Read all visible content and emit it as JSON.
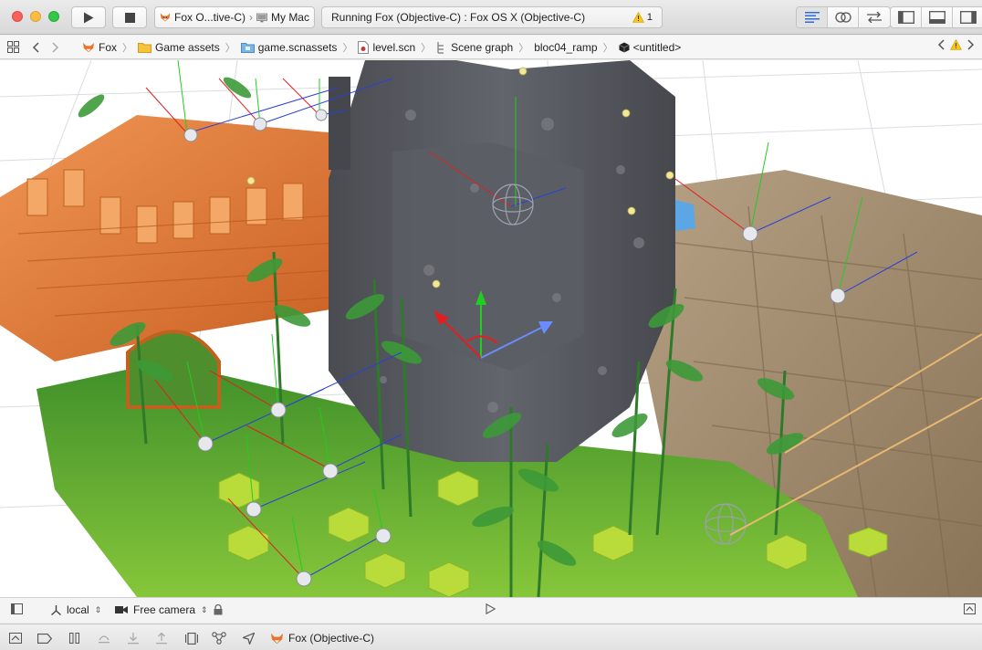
{
  "toolbar": {
    "scheme_name": "Fox O...tive-C)",
    "device_name": "My Mac",
    "activity_text": "Running Fox (Objective-C) : Fox OS X (Objective-C)",
    "warning_count": "1"
  },
  "jumpbar": {
    "crumbs": [
      {
        "label": "Fox",
        "icon": "project-icon"
      },
      {
        "label": "Game assets",
        "icon": "folder-icon"
      },
      {
        "label": "game.scnassets",
        "icon": "scnassets-folder-icon"
      },
      {
        "label": "level.scn",
        "icon": "scene-file-icon"
      },
      {
        "label": "Scene graph",
        "icon": "scene-graph-icon"
      },
      {
        "label": "bloc04_ramp",
        "icon": ""
      },
      {
        "label": "<untitled>",
        "icon": "cube-icon"
      }
    ]
  },
  "scenebar": {
    "coordinate_mode": "local",
    "camera": "Free camera"
  },
  "debugbar": {
    "process_label": "Fox (Objective-C)"
  },
  "colors": {
    "accent_blue": "#2d6fd6",
    "warning_yellow": "#f5c518",
    "traffic_red": "#fc605c",
    "traffic_yellow": "#fdbc40",
    "traffic_green": "#34c84a",
    "grass": "#6bb52e",
    "rock": "#56585e",
    "brick": "#e07a34",
    "stone_path": "#9d8a6f"
  }
}
